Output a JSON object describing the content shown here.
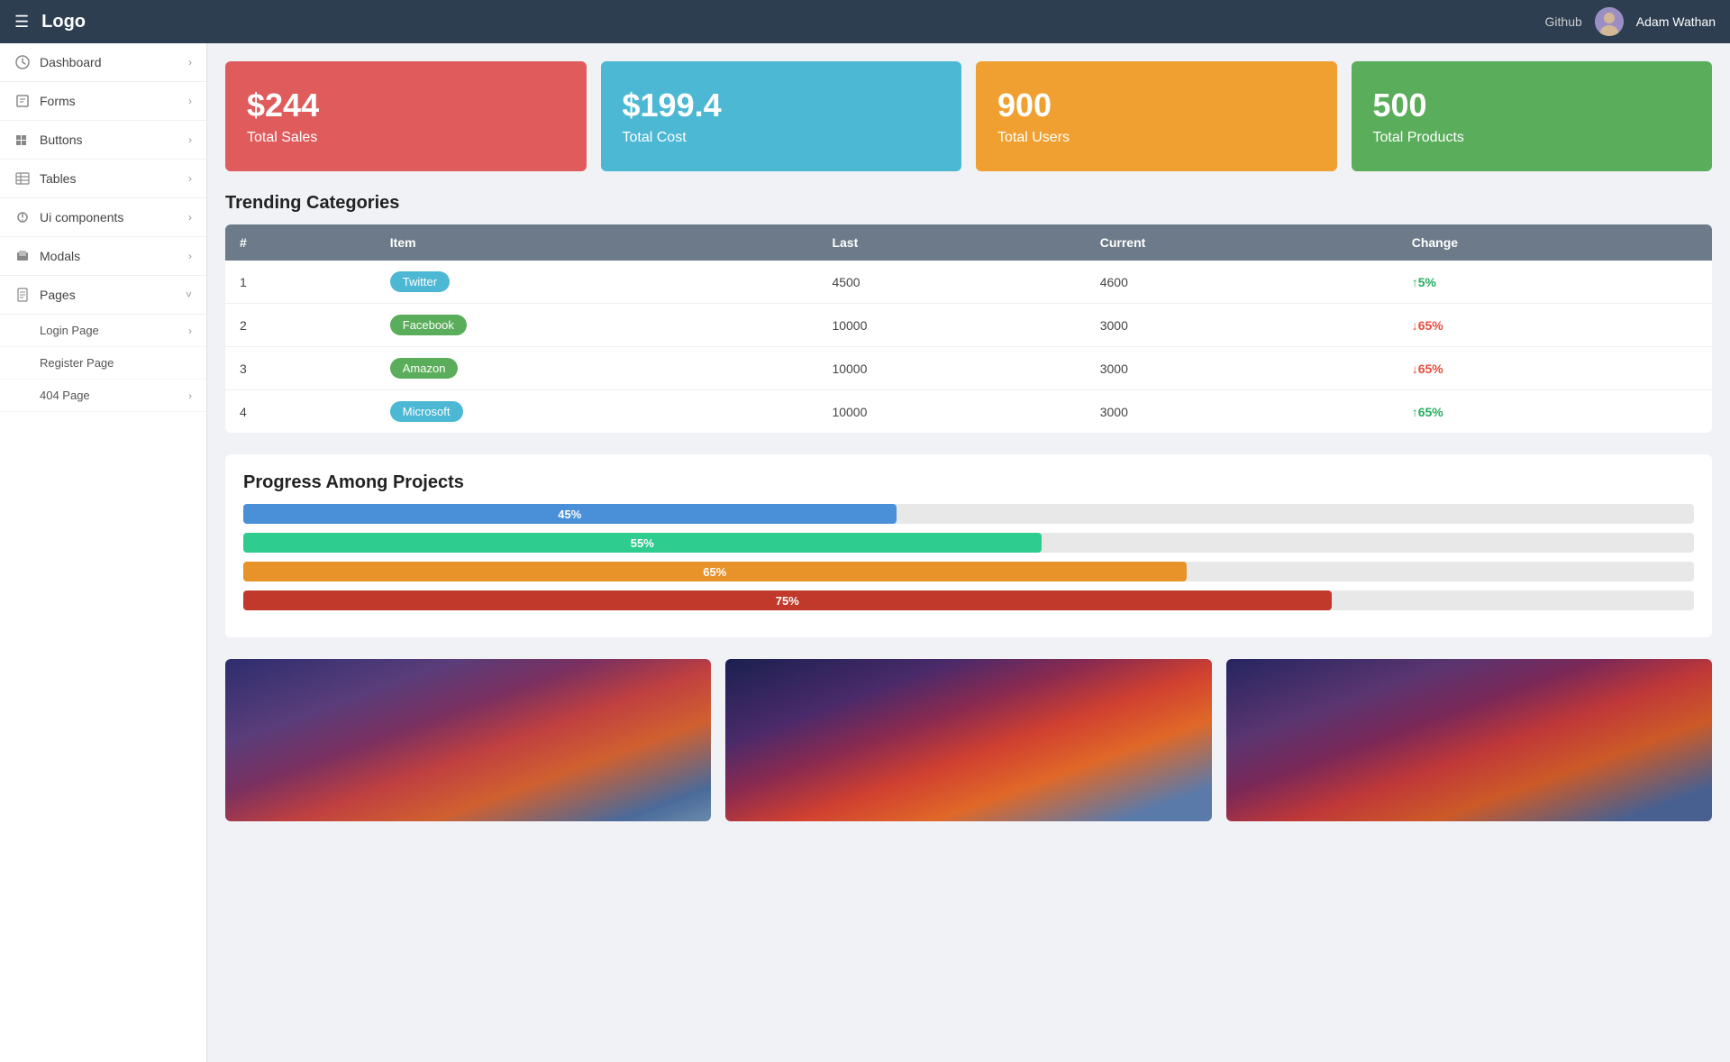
{
  "topnav": {
    "hamburger": "☰",
    "logo": "Logo",
    "github": "Github",
    "username": "Adam Wathan"
  },
  "sidebar": {
    "items": [
      {
        "id": "dashboard",
        "label": "Dashboard",
        "icon": "dashboard-icon",
        "hasChevron": true,
        "expanded": false
      },
      {
        "id": "forms",
        "label": "Forms",
        "icon": "forms-icon",
        "hasChevron": true,
        "expanded": false
      },
      {
        "id": "buttons",
        "label": "Buttons",
        "icon": "buttons-icon",
        "hasChevron": true,
        "expanded": false
      },
      {
        "id": "tables",
        "label": "Tables",
        "icon": "tables-icon",
        "hasChevron": true,
        "expanded": false
      },
      {
        "id": "ui-components",
        "label": "Ui components",
        "icon": "ui-icon",
        "hasChevron": true,
        "expanded": false
      },
      {
        "id": "modals",
        "label": "Modals",
        "icon": "modals-icon",
        "hasChevron": true,
        "expanded": false
      },
      {
        "id": "pages",
        "label": "Pages",
        "icon": "pages-icon",
        "hasChevron": true,
        "expanded": true
      }
    ],
    "sub_items": [
      {
        "id": "login-page",
        "label": "Login Page",
        "hasChevron": true
      },
      {
        "id": "register-page",
        "label": "Register Page",
        "hasChevron": false
      },
      {
        "id": "404-page",
        "label": "404 Page",
        "hasChevron": true
      }
    ]
  },
  "stats": [
    {
      "id": "total-sales",
      "value": "$244",
      "label": "Total Sales",
      "color_class": "card-red"
    },
    {
      "id": "total-cost",
      "value": "$199.4",
      "label": "Total Cost",
      "color_class": "card-blue"
    },
    {
      "id": "total-users",
      "value": "900",
      "label": "Total Users",
      "color_class": "card-orange"
    },
    {
      "id": "total-products",
      "value": "500",
      "label": "Total Products",
      "color_class": "card-green"
    }
  ],
  "trending": {
    "title": "Trending Categories",
    "columns": [
      "#",
      "Item",
      "Last",
      "Current",
      "Change"
    ],
    "rows": [
      {
        "num": "1",
        "item": "Twitter",
        "badge_class": "badge-twitter",
        "last": "4500",
        "current": "4600",
        "change": "5%",
        "direction": "up"
      },
      {
        "num": "2",
        "item": "Facebook",
        "badge_class": "badge-facebook",
        "last": "10000",
        "current": "3000",
        "change": "65%",
        "direction": "down"
      },
      {
        "num": "3",
        "item": "Amazon",
        "badge_class": "badge-amazon",
        "last": "10000",
        "current": "3000",
        "change": "65%",
        "direction": "down"
      },
      {
        "num": "4",
        "item": "Microsoft",
        "badge_class": "badge-microsoft",
        "last": "10000",
        "current": "3000",
        "change": "65%",
        "direction": "up"
      }
    ]
  },
  "progress": {
    "title": "Progress Among Projects",
    "bars": [
      {
        "id": "bar-1",
        "pct": 45,
        "label": "45%",
        "color_class": "p-blue"
      },
      {
        "id": "bar-2",
        "pct": 55,
        "label": "55%",
        "color_class": "p-teal"
      },
      {
        "id": "bar-3",
        "pct": 65,
        "label": "65%",
        "color_class": "p-orange"
      },
      {
        "id": "bar-4",
        "pct": 75,
        "label": "75%",
        "color_class": "p-red"
      }
    ]
  },
  "images": [
    {
      "id": "img-1"
    },
    {
      "id": "img-2"
    },
    {
      "id": "img-3"
    }
  ]
}
